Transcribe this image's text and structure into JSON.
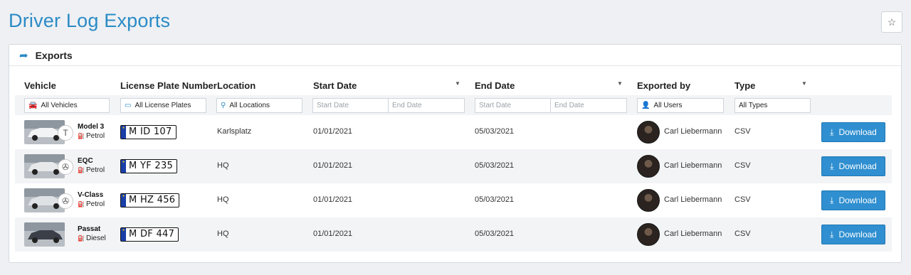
{
  "page": {
    "title": "Driver Log Exports"
  },
  "icons": {
    "favorite": "star-icon",
    "exports": "share-arrow-icon"
  },
  "panel": {
    "title": "Exports"
  },
  "columns": {
    "vehicle": "Vehicle",
    "plate": "License Plate Number",
    "location": "Location",
    "start": "Start Date",
    "end": "End Date",
    "exported_by": "Exported by",
    "type": "Type"
  },
  "filters": {
    "vehicles": "All Vehicles",
    "plates": "All License Plates",
    "locations": "All Locations",
    "start_from": "Start Date",
    "start_to": "End Date",
    "end_from": "Start Date",
    "end_to": "End Date",
    "users": "All Users",
    "types": "All Types"
  },
  "colors": {
    "accent": "#2b8bc6",
    "button": "#2f8fd0"
  },
  "rows": [
    {
      "model": "Model 3",
      "fuel": "Petrol",
      "brand_icon": "tesla-icon",
      "plate": "M ID 107",
      "location": "Karlsplatz",
      "start": "01/01/2021",
      "end": "05/03/2021",
      "user": "Carl Liebermann",
      "type": "CSV",
      "action": "Download"
    },
    {
      "model": "EQC",
      "fuel": "Petrol",
      "brand_icon": "mercedes-icon",
      "plate": "M YF 235",
      "location": "HQ",
      "start": "01/01/2021",
      "end": "05/03/2021",
      "user": "Carl Liebermann",
      "type": "CSV",
      "action": "Download"
    },
    {
      "model": "V-Class",
      "fuel": "Petrol",
      "brand_icon": "mercedes-icon",
      "plate": "M HZ 456",
      "location": "HQ",
      "start": "01/01/2021",
      "end": "05/03/2021",
      "user": "Carl Liebermann",
      "type": "CSV",
      "action": "Download"
    },
    {
      "model": "Passat",
      "fuel": "Diesel",
      "brand_icon": "vw-icon",
      "plate": "M DF 447",
      "location": "HQ",
      "start": "01/01/2021",
      "end": "05/03/2021",
      "user": "Carl Liebermann",
      "type": "CSV",
      "action": "Download"
    }
  ]
}
